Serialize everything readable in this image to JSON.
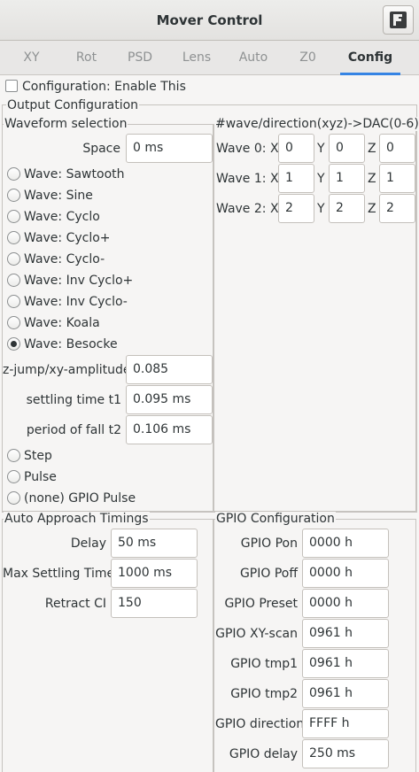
{
  "window": {
    "title": "Mover Control",
    "menu_icon": "app-menu-icon"
  },
  "tabs": [
    "XY",
    "Rot",
    "PSD",
    "Lens",
    "Auto",
    "Z0",
    "Config"
  ],
  "active_tab": "Config",
  "enable": {
    "label": "Configuration: Enable This",
    "checked": false
  },
  "output": {
    "title": "Output Configuration",
    "waveform": {
      "title": "Waveform selection",
      "space_label": "Space",
      "space_value": "0 ms",
      "waves": [
        "Wave: Sawtooth",
        "Wave: Sine",
        "Wave: Cyclo",
        "Wave: Cyclo+",
        "Wave: Cyclo-",
        "Wave: Inv Cyclo+",
        "Wave: Inv Cyclo-",
        "Wave: Koala",
        "Wave: Besocke"
      ],
      "selected": "Wave: Besocke",
      "params": [
        {
          "label": "z-jump/xy-amplitude",
          "value": "0.085"
        },
        {
          "label": "settling time t1",
          "value": "0.095 ms"
        },
        {
          "label": "period of fall t2",
          "value": "0.106 ms"
        }
      ],
      "others": [
        "Step",
        "Pulse",
        "(none) GPIO Pulse"
      ]
    },
    "dac": {
      "title": "#wave/direction(xyz)->DAC(0-6)",
      "rows": [
        {
          "label": "Wave 0: X",
          "x": "0",
          "y_label": "Y",
          "y": "0",
          "z_label": "Z",
          "z": "0"
        },
        {
          "label": "Wave 1: X",
          "x": "1",
          "y_label": "Y",
          "y": "1",
          "z_label": "Z",
          "z": "1"
        },
        {
          "label": "Wave 2: X",
          "x": "2",
          "y_label": "Y",
          "y": "2",
          "z_label": "Z",
          "z": "2"
        }
      ]
    }
  },
  "auto": {
    "title": "Auto Approach Timings",
    "rows": [
      {
        "label": "Delay",
        "value": "50 ms"
      },
      {
        "label": "Max Settling Time",
        "value": "1000 ms"
      },
      {
        "label": "Retract CI",
        "value": "150"
      }
    ]
  },
  "gpio": {
    "title": "GPIO Configuration",
    "rows": [
      {
        "label": "GPIO Pon",
        "value": "0000 h"
      },
      {
        "label": "GPIO Poff",
        "value": "0000 h"
      },
      {
        "label": "GPIO Preset",
        "value": "0000 h"
      },
      {
        "label": "GPIO XY-scan",
        "value": "0961 h"
      },
      {
        "label": "GPIO tmp1",
        "value": "0961 h"
      },
      {
        "label": "GPIO tmp2",
        "value": "0961 h"
      },
      {
        "label": "GPIO direction",
        "value": "FFFF h"
      },
      {
        "label": "GPIO delay",
        "value": "250 ms"
      }
    ]
  }
}
